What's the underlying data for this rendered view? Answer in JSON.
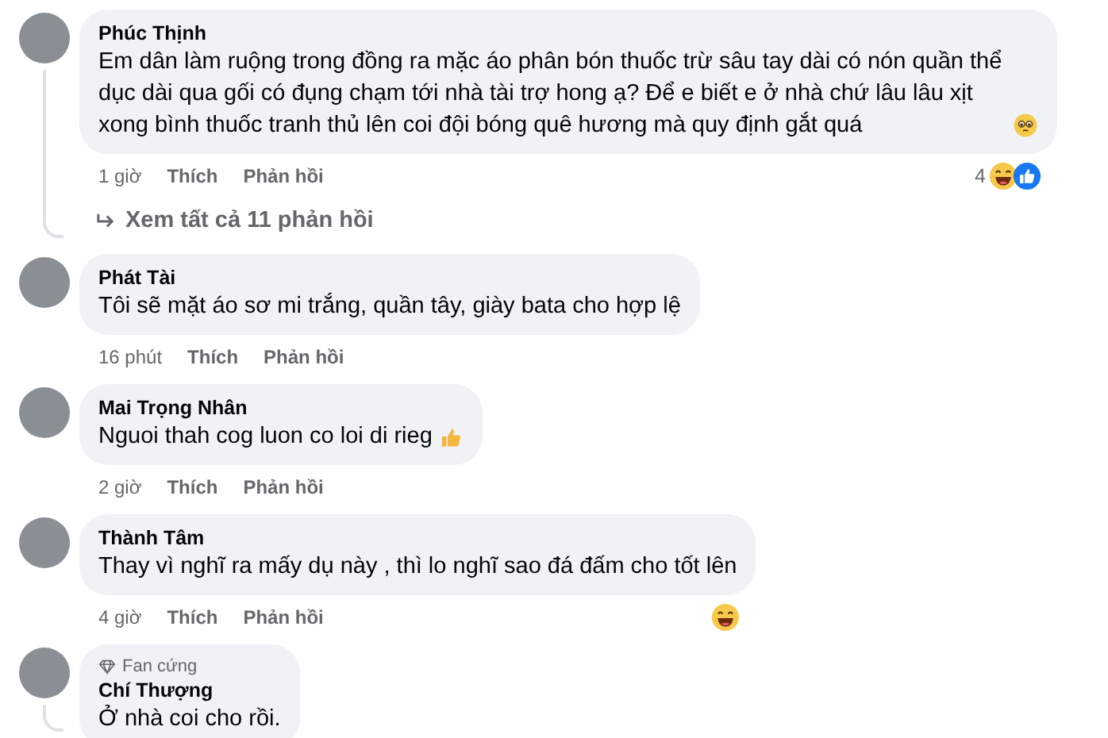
{
  "comments": [
    {
      "author": "Phúc Thịnh",
      "text": "Em dân làm ruộng trong đồng ra mặc áo phân bón thuốc trừ sâu tay dài có nón quần thể dục dài qua gối có đụng chạm tới nhà tài trợ hong ạ? Để e biết e ở nhà chứ lâu lâu xịt xong bình thuốc tranh thủ lên coi đội bóng quê hương mà quy định gắt quá",
      "emoji": {
        "kind": "teary_face"
      },
      "time": "1 giờ",
      "like": "Thích",
      "reply": "Phản hồi",
      "reaction_count": "4",
      "reactions": [
        {
          "kind": "haha"
        },
        {
          "kind": "like"
        }
      ],
      "more_replies": "Xem tất cả 11 phản hồi"
    },
    {
      "author": "Phát Tài",
      "text": "Tôi sẽ mặt áo sơ mi trắng, quần tây, giày bata cho hợp lệ",
      "time": "16 phút",
      "like": "Thích",
      "reply": "Phản hồi"
    },
    {
      "author": "Mai Trọng Nhân",
      "text": "Nguoi thah cog luon co loi di rieg",
      "emoji": {
        "kind": "thumbs_up"
      },
      "time": "2 giờ",
      "like": "Thích",
      "reply": "Phản hồi"
    },
    {
      "author": "Thành Tâm",
      "text": "Thay vì nghĩ ra mấy dụ này , thì lo nghĩ sao đá đấm cho tốt lên",
      "time": "4 giờ",
      "like": "Thích",
      "reply": "Phản hồi",
      "reactions": [
        {
          "kind": "haha"
        }
      ]
    },
    {
      "author": "Chí Thượng",
      "badge": "Fan cứng",
      "text": "Ở nhà coi cho rồi."
    }
  ]
}
